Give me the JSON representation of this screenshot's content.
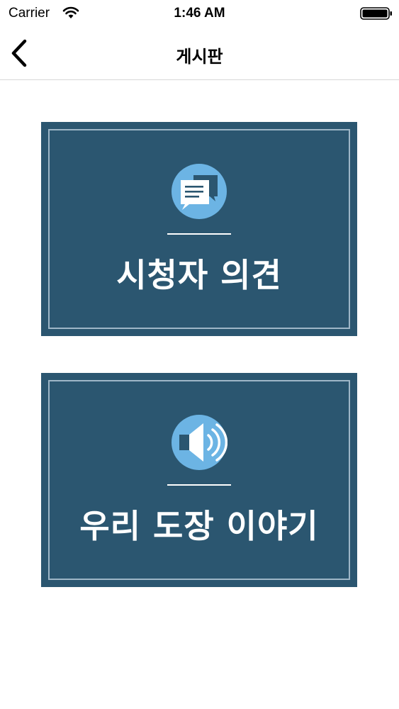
{
  "status_bar": {
    "carrier": "Carrier",
    "time": "1:46 AM",
    "icons": [
      "wifi-icon",
      "battery-icon"
    ]
  },
  "nav": {
    "title": "게시판",
    "back_icon": "chevron-left-icon"
  },
  "cards": [
    {
      "label": "시청자 의견",
      "icon": "chat-bubble-icon"
    },
    {
      "label": "우리 도장 이야기",
      "icon": "speaker-icon"
    }
  ],
  "colors": {
    "card_background": "#2b5670",
    "card_frame": "#9eb6c7",
    "icon_circle": "#6cb4e4",
    "text_on_card": "#ffffff"
  }
}
